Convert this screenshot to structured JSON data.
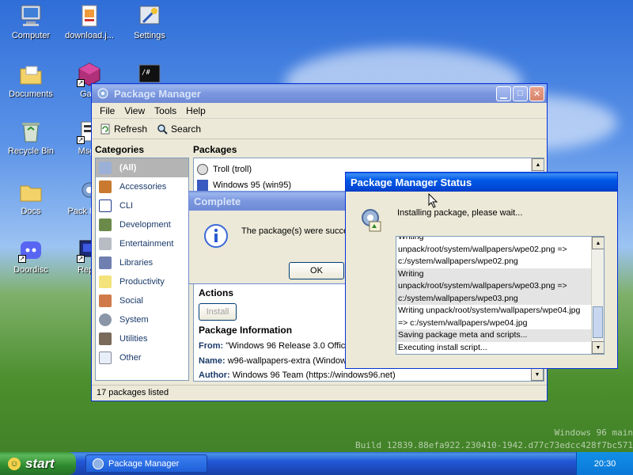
{
  "desktop": {
    "icons": [
      {
        "label": "Computer"
      },
      {
        "label": "download.j..."
      },
      {
        "label": "Settings"
      },
      {
        "label": "Documents"
      },
      {
        "label": "Gam"
      },
      {
        "label": "Recycle Bin"
      },
      {
        "label": "MsgR"
      },
      {
        "label": "Docs"
      },
      {
        "label": "Pack Mana"
      },
      {
        "label": "Doordisc"
      },
      {
        "label": "Repor"
      }
    ],
    "watermark_line1": "Windows 96 main",
    "watermark_line2": "Build 12839.88efa922.230410-1942.d77c73edcc428f7bc571"
  },
  "package_manager": {
    "title": "Package Manager",
    "menu": [
      "File",
      "View",
      "Tools",
      "Help"
    ],
    "toolbar": {
      "refresh": "Refresh",
      "search": "Search"
    },
    "categories_header": "Categories",
    "packages_header": "Packages",
    "categories": [
      "(All)",
      "Accessories",
      "CLI",
      "Development",
      "Entertainment",
      "Libraries",
      "Productivity",
      "Social",
      "System",
      "Utilities",
      "Other"
    ],
    "packages": [
      "Troll (troll)",
      "Windows 95 (win95)"
    ],
    "actions_header": "Actions",
    "install_button": "Install",
    "package_info_header": "Package Information",
    "info": [
      {
        "key": "From:",
        "value": "\"Windows 96 Release 3.0 Officia"
      },
      {
        "key": "Name:",
        "value": "w96-wallpapers-extra (Windows"
      },
      {
        "key": "Author:",
        "value": "Windows 96 Team (https://windows96.net)"
      }
    ],
    "status_bar": "17 packages listed"
  },
  "complete_dialog": {
    "title": "Complete",
    "message": "The package(s) were succe",
    "ok_button": "OK"
  },
  "status_window": {
    "title": "Package Manager Status",
    "message": "Installing package, please wait...",
    "log": [
      "Writing",
      "unpack/root/system/wallpapers/wpe02.png =>",
      "c:/system/wallpapers/wpe02.png",
      "Writing",
      "unpack/root/system/wallpapers/wpe03.png =>",
      "c:/system/wallpapers/wpe03.png",
      "Writing unpack/root/system/wallpapers/wpe04.jpg",
      "=> c:/system/wallpapers/wpe04.jpg",
      "Saving package meta and scripts...",
      "Executing install script..."
    ]
  },
  "taskbar": {
    "start_label": "start",
    "task_label": "Package Manager",
    "clock": "20:30"
  }
}
